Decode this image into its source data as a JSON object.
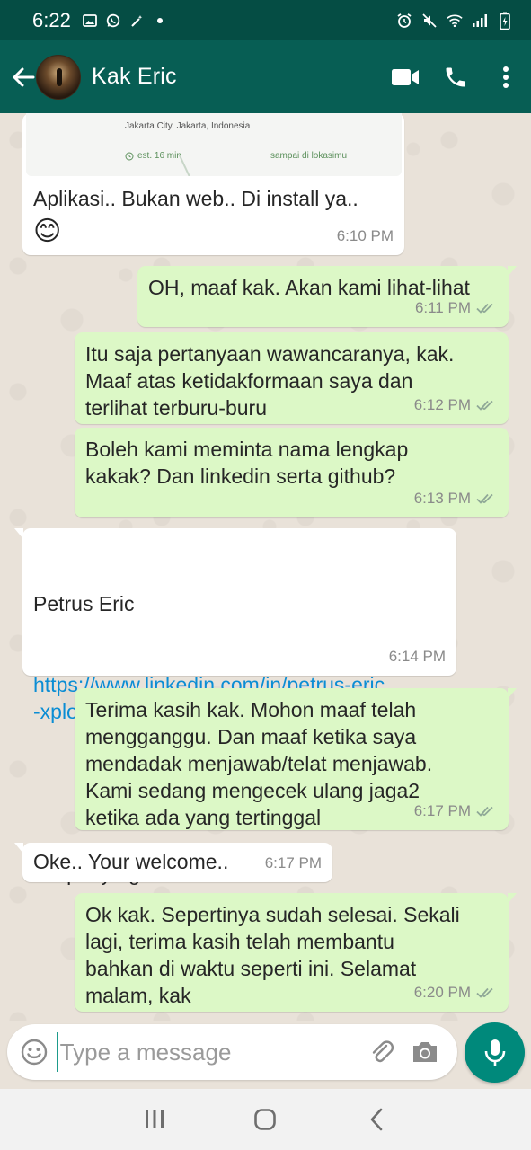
{
  "status_bar": {
    "time": "6:22",
    "left_icons": [
      "image-icon",
      "whatsapp-icon",
      "magic-wand-icon",
      "dot-icon"
    ],
    "right_icons": [
      "alarm-icon",
      "mute-icon",
      "wifi-icon",
      "signal-icon",
      "battery-icon"
    ]
  },
  "header": {
    "contact_name": "Kak Eric",
    "actions": [
      "video-call-icon",
      "phone-icon",
      "more-vert-icon"
    ]
  },
  "map_preview": {
    "address": "Jakarta City, Jakarta, Indonesia",
    "estimate": "est. 16 min",
    "destination": "sampai di lokasimu"
  },
  "messages": [
    {
      "side": "in",
      "text": "Aplikasi.. Bukan web.. Di install ya..",
      "emoji": "😊",
      "time": "6:10 PM"
    },
    {
      "side": "out",
      "text": "OH, maaf kak. Akan kami lihat-lihat",
      "time": "6:11 PM"
    },
    {
      "side": "out",
      "text": "Itu saja pertanyaan wawancaranya, kak.\nMaaf atas ketidakformaan saya dan\nterlihat terburu-buru",
      "time": "6:12 PM"
    },
    {
      "side": "out",
      "text": "Boleh kami meminta nama lengkap\nkakak? Dan linkedin serta github?",
      "time": "6:13 PM"
    },
    {
      "side": "in",
      "name": "Petrus Eric",
      "link": "https://www.linkedin.com/in/petrus-eric\n-xplodedbox/",
      "text": "Ga punya github.. ^^a",
      "time": "6:14 PM"
    },
    {
      "side": "out",
      "text": "Terima kasih kak. Mohon maaf telah\nmengganggu. Dan maaf ketika saya\nmendadak menjawab/telat menjawab.\nKami sedang mengecek ulang jaga2\nketika ada yang tertinggal",
      "time": "6:17 PM"
    },
    {
      "side": "in",
      "text": "Oke.. Your welcome..",
      "time": "6:17 PM"
    },
    {
      "side": "out",
      "text": "Ok kak. Sepertinya sudah selesai. Sekali\nlagi, terima kasih telah membantu\nbahkan di waktu seperti ini. Selamat\nmalam, kak",
      "time": "6:20 PM"
    }
  ],
  "input": {
    "placeholder": "Type a message",
    "value": ""
  },
  "colors": {
    "status_bar": "#054d44",
    "header": "#075e54",
    "outgoing_bubble": "#dcf8c6",
    "incoming_bubble": "#ffffff",
    "link": "#0b8dd4",
    "mic_button": "#00897b"
  },
  "nav_bar": [
    "recents-icon",
    "home-icon",
    "back-nav-icon"
  ]
}
